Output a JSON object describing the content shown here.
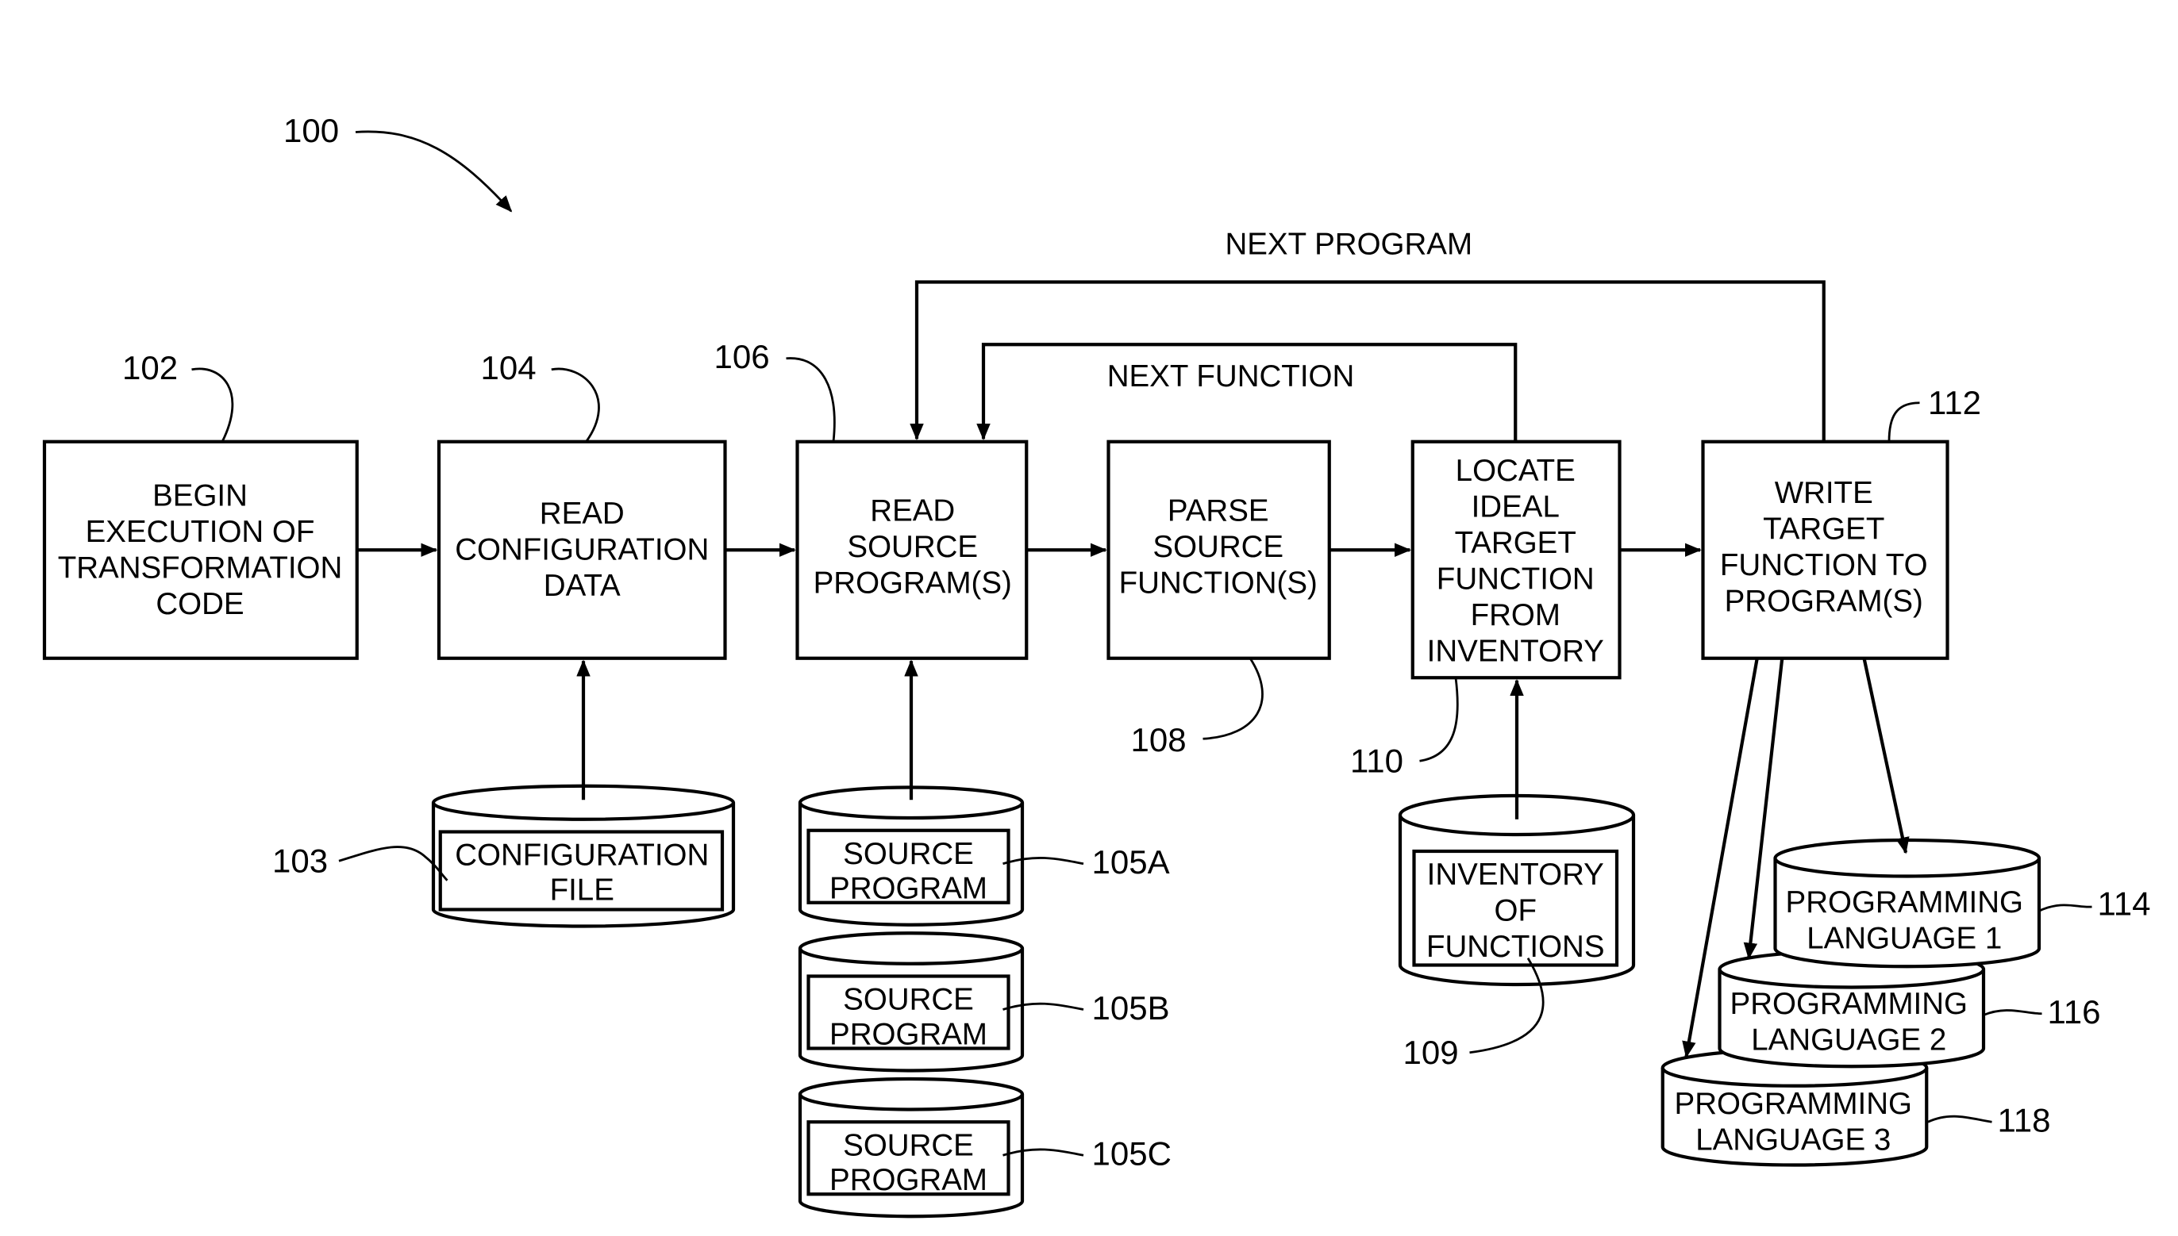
{
  "figure_ref": "100",
  "loops": {
    "next_program": "NEXT PROGRAM",
    "next_function": "NEXT FUNCTION"
  },
  "steps": [
    {
      "ref": "102",
      "lines": [
        "BEGIN",
        "EXECUTION OF",
        "TRANSFORMATION",
        "CODE"
      ]
    },
    {
      "ref": "104",
      "lines": [
        "READ",
        "CONFIGURATION",
        "DATA"
      ]
    },
    {
      "ref": "106",
      "lines": [
        "READ",
        "SOURCE",
        "PROGRAM(S)"
      ]
    },
    {
      "ref": "108",
      "lines": [
        "PARSE",
        "SOURCE",
        "FUNCTION(S)"
      ]
    },
    {
      "ref": "110",
      "lines": [
        "LOCATE",
        "IDEAL",
        "TARGET",
        "FUNCTION",
        "FROM",
        "INVENTORY"
      ]
    },
    {
      "ref": "112",
      "lines": [
        "WRITE",
        "TARGET",
        "FUNCTION TO",
        "PROGRAM(S)"
      ]
    }
  ],
  "stores": [
    {
      "ref": "103",
      "lines": [
        "CONFIGURATION",
        "FILE"
      ]
    },
    {
      "ref": "105A",
      "lines": [
        "SOURCE",
        "PROGRAM"
      ]
    },
    {
      "ref": "105B",
      "lines": [
        "SOURCE",
        "PROGRAM"
      ]
    },
    {
      "ref": "105C",
      "lines": [
        "SOURCE",
        "PROGRAM"
      ]
    },
    {
      "ref": "109",
      "lines": [
        "INVENTORY",
        "OF",
        "FUNCTIONS"
      ]
    },
    {
      "ref": "114",
      "lines": [
        "PROGRAMMING",
        "LANGUAGE 1"
      ]
    },
    {
      "ref": "116",
      "lines": [
        "PROGRAMMING",
        "LANGUAGE 2"
      ]
    },
    {
      "ref": "118",
      "lines": [
        "PROGRAMMING",
        "LANGUAGE 3"
      ]
    }
  ]
}
